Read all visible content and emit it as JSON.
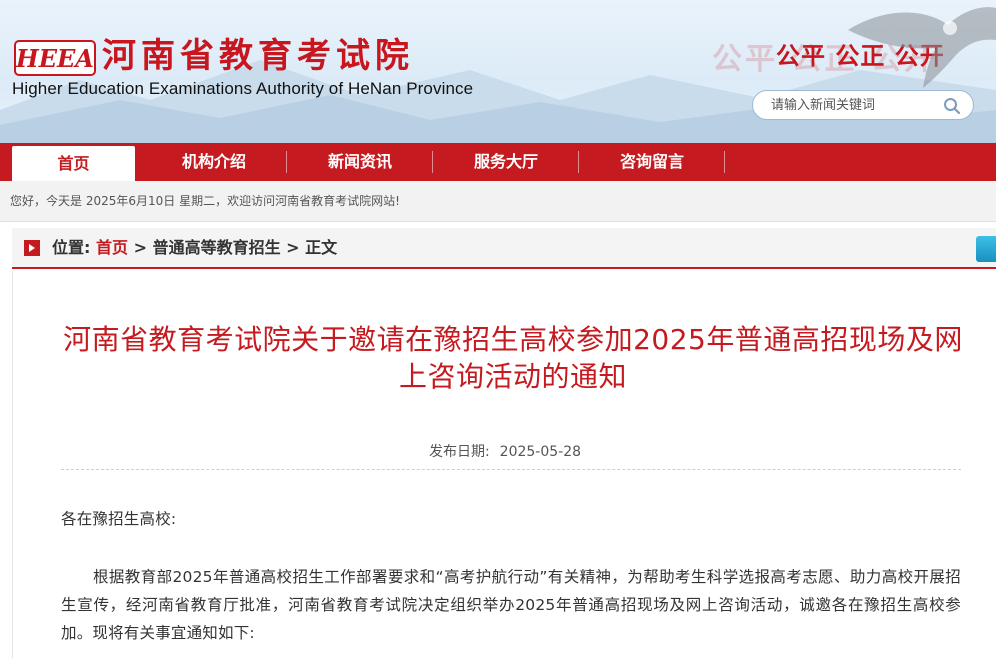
{
  "header": {
    "logo_text": "HEEA",
    "title": "河南省教育考试院",
    "subtitle": "Higher Education Examinations Authority of HeNan Province",
    "slogan": "公平 公正 公开",
    "slogan_faint": "公平 公正 公开",
    "search_placeholder": "请输入新闻关键词"
  },
  "nav": {
    "items": [
      {
        "label": "首页",
        "active": true
      },
      {
        "label": "机构介绍",
        "active": false
      },
      {
        "label": "新闻资讯",
        "active": false
      },
      {
        "label": "服务大厅",
        "active": false
      },
      {
        "label": "咨询留言",
        "active": false
      }
    ]
  },
  "welcome": "您好，今天是 2025年6月10日 星期二，欢迎访问河南省教育考试院网站!",
  "breadcrumb": {
    "prefix": "位置:",
    "home": "首页",
    "sep": ">",
    "section": "普通高等教育招生",
    "current": "正文"
  },
  "article": {
    "title": "河南省教育考试院关于邀请在豫招生高校参加2025年普通高招现场及网上咨询活动的通知",
    "date_label": "发布日期:",
    "date_value": "2025-05-28",
    "greeting": "各在豫招生高校:",
    "paragraph": "根据教育部2025年普通高校招生工作部署要求和“高考护航行动”有关精神，为帮助考生科学选报高考志愿、助力高校开展招生宣传，经河南省教育厅批准，河南省教育考试院决定组织举办2025年普通高招现场及网上咨询活动，诚邀各在豫招生高校参加。现将有关事宜通知如下:"
  },
  "colors": {
    "brand_red": "#c51a1f",
    "header_bg": "#dcebf7"
  },
  "icons": [
    "logo-badge",
    "eagle-image",
    "search-icon",
    "location-icon",
    "side-tool-icon"
  ]
}
